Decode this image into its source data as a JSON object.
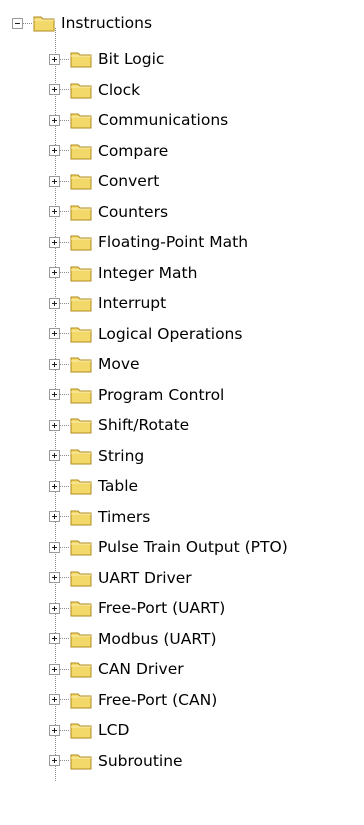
{
  "tree": {
    "root": {
      "label": "Instructions",
      "expanded": true,
      "toggle_icon": "minus-box-icon",
      "icon": "folder-icon"
    },
    "folder_color": "#f2d96a",
    "children": [
      {
        "label": "Bit Logic",
        "icon": "folder-icon",
        "toggle_icon": "plus-box-icon"
      },
      {
        "label": "Clock",
        "icon": "folder-icon",
        "toggle_icon": "plus-box-icon"
      },
      {
        "label": "Communications",
        "icon": "folder-icon",
        "toggle_icon": "plus-box-icon"
      },
      {
        "label": "Compare",
        "icon": "folder-icon",
        "toggle_icon": "plus-box-icon"
      },
      {
        "label": "Convert",
        "icon": "folder-icon",
        "toggle_icon": "plus-box-icon"
      },
      {
        "label": "Counters",
        "icon": "folder-icon",
        "toggle_icon": "plus-box-icon"
      },
      {
        "label": "Floating-Point Math",
        "icon": "folder-icon",
        "toggle_icon": "plus-box-icon"
      },
      {
        "label": "Integer Math",
        "icon": "folder-icon",
        "toggle_icon": "plus-box-icon"
      },
      {
        "label": "Interrupt",
        "icon": "folder-icon",
        "toggle_icon": "plus-box-icon"
      },
      {
        "label": "Logical Operations",
        "icon": "folder-icon",
        "toggle_icon": "plus-box-icon"
      },
      {
        "label": "Move",
        "icon": "folder-icon",
        "toggle_icon": "plus-box-icon"
      },
      {
        "label": "Program Control",
        "icon": "folder-icon",
        "toggle_icon": "plus-box-icon"
      },
      {
        "label": "Shift/Rotate",
        "icon": "folder-icon",
        "toggle_icon": "plus-box-icon"
      },
      {
        "label": "String",
        "icon": "folder-icon",
        "toggle_icon": "plus-box-icon"
      },
      {
        "label": "Table",
        "icon": "folder-icon",
        "toggle_icon": "plus-box-icon"
      },
      {
        "label": "Timers",
        "icon": "folder-icon",
        "toggle_icon": "plus-box-icon"
      },
      {
        "label": "Pulse Train Output (PTO)",
        "icon": "folder-icon",
        "toggle_icon": "plus-box-icon"
      },
      {
        "label": "UART Driver",
        "icon": "folder-icon",
        "toggle_icon": "plus-box-icon"
      },
      {
        "label": "Free-Port (UART)",
        "icon": "folder-icon",
        "toggle_icon": "plus-box-icon"
      },
      {
        "label": "Modbus (UART)",
        "icon": "folder-icon",
        "toggle_icon": "plus-box-icon"
      },
      {
        "label": "CAN Driver",
        "icon": "folder-icon",
        "toggle_icon": "plus-box-icon"
      },
      {
        "label": "Free-Port (CAN)",
        "icon": "folder-icon",
        "toggle_icon": "plus-box-icon"
      },
      {
        "label": "LCD",
        "icon": "folder-icon",
        "toggle_icon": "plus-box-icon"
      },
      {
        "label": "Subroutine",
        "icon": "folder-icon",
        "toggle_icon": "plus-box-icon"
      }
    ]
  }
}
